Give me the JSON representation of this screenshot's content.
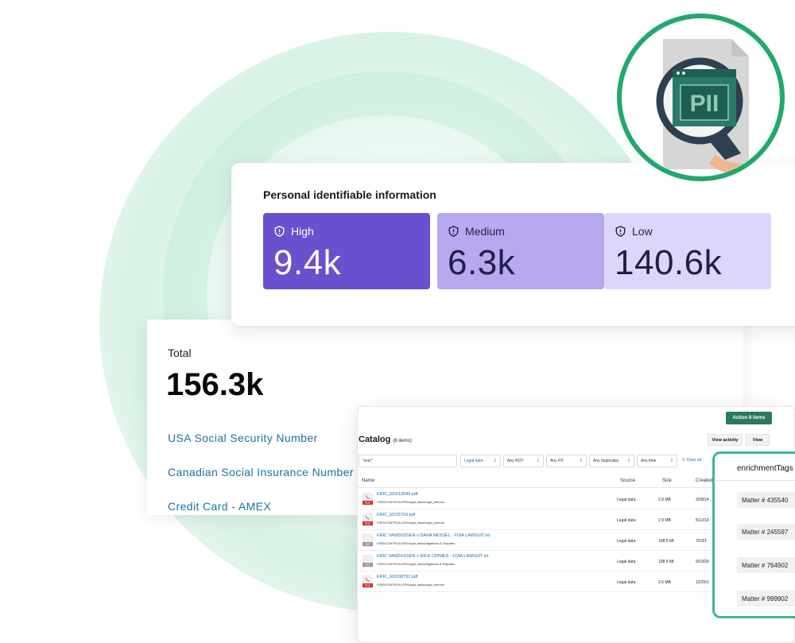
{
  "pii": {
    "title": "Personal identifiable information",
    "levels": [
      {
        "label": "High",
        "value": "9.4k",
        "color": "#6a4fcf"
      },
      {
        "label": "Medium",
        "value": "6.3k",
        "color": "#b8a8f0"
      },
      {
        "label": "Low",
        "value": "140.6k",
        "color": "#ddd6fb"
      }
    ]
  },
  "total": {
    "label": "Total",
    "value": "156.3k",
    "types": [
      "USA Social Security Number",
      "Canadian Social Insurance Number",
      "Credit Card - AMEX"
    ]
  },
  "badge": {
    "text": "PII"
  },
  "catalog": {
    "action_label": "Action 8 items",
    "title": "Catalog",
    "count": "(8 items)",
    "view_activity": "View activity",
    "view": "View",
    "search_value": "\"eric\"",
    "filters": [
      "Legal data",
      "Any ROT",
      "Any PII",
      "Any duplicates",
      "Any time"
    ],
    "clear_all": "Clear all",
    "columns": {
      "name": "Name",
      "source": "Source",
      "size": "Size",
      "created": "Created"
    },
    "rows": [
      {
        "name": "ERIC_ED012644.pdf",
        "path": "\\\\SEDCONTROLLER\\Legal_data\\Legal_memos",
        "source": "Legal data",
        "size": "2.9 MB",
        "created": "3/28/14",
        "icon": "pdf-icon"
      },
      {
        "name": "ERIC_ED25703.pdf",
        "path": "\\\\SEDCONTROLLER\\Legal_data\\Legal_memos",
        "source": "Legal data",
        "size": "2.9 MB",
        "created": "5/12/19",
        "icon": "pdf-icon"
      },
      {
        "name": "ERIC VANDUSSEN v DANA NESSEL - FOIA LAWSUIT.txt",
        "path": "\\\\SEDCONTROLLER\\Legal_data\\Litigations & Disputes",
        "source": "Legal data",
        "size": "108.5 kB",
        "created": "7/23/1",
        "icon": "txt-icon"
      },
      {
        "name": "ERIC VANDUSSEN v RICK CRIMES - FOIA LAWSUIT.txt",
        "path": "\\\\SEDCONTROLLER\\Legal_data\\Litigations & Disputes",
        "source": "Legal data",
        "size": "108.5 kB",
        "created": "9/10/20",
        "icon": "txt-icon"
      },
      {
        "name": "ERIC_ED038792.pdf",
        "path": "\\\\SEDCONTROLLER\\Legal_data\\Legal_memos",
        "source": "Legal data",
        "size": "2.6 MB",
        "created": "12/20/1",
        "icon": "pdf-icon"
      }
    ]
  },
  "enrichment": {
    "title": "enrichmentTags",
    "tags": [
      "Matter # 435540",
      "Matter # 245597",
      "Matter # 764902",
      "Matter # 999902"
    ]
  }
}
